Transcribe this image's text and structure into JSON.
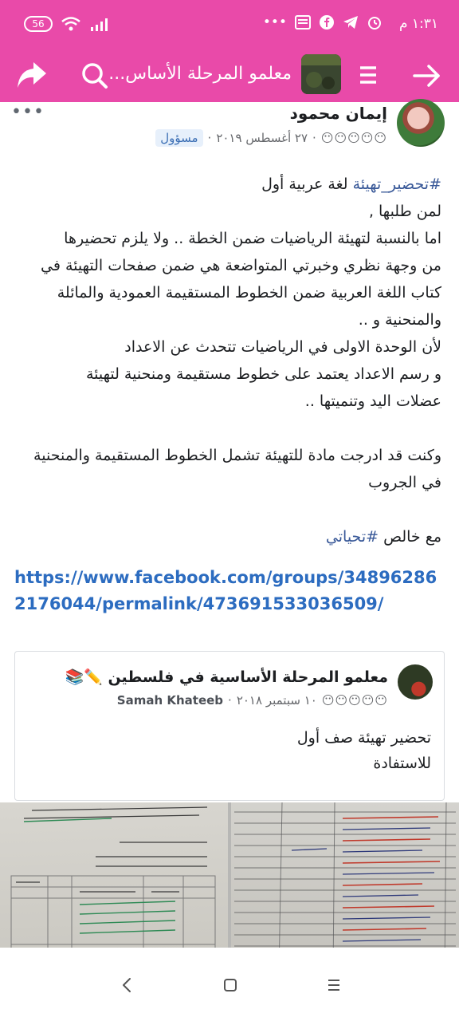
{
  "status_bar": {
    "time": "١:٣١ م",
    "battery": "56",
    "dots": "•••"
  },
  "app_bar": {
    "group_title": "معلمو المرحلة الأساس..."
  },
  "post": {
    "author": "إيمان محمود",
    "role_badge": "مسؤول",
    "date": "٢٧ أغسطس ٢٠١٩",
    "separator": "·",
    "privacy_icons": "😶😶😶😶😶",
    "more": "•••",
    "text": {
      "line1_hashtag": "#تحضير_تهيئة",
      "line1_rest": " لغة عربية أول",
      "line2": "لمن طلبها ,",
      "line3": "اما بالنسبة لتهيئة الرياضيات ضمن الخطة .. ولا يلزم تحضيرها",
      "line4": "من وجهة نظري وخبرتي المتواضعة هي ضمن صفحات التهيئة في",
      "line5": "كتاب اللغة العربية ضمن الخطوط المستقيمة العمودية والمائلة",
      "line6": "والمنحنية و ..",
      "line7": "لأن الوحدة الاولى في الرياضيات تتحدث عن الاعداد",
      "line8": "و رسم الاعداد يعتمد على خطوط مستقيمة ومنحنية لتهيئة",
      "line9": "عضلات اليد وتنميتها ..",
      "line10": "وكنت قد ادرجت مادة للتهيئة تشمل الخطوط المستقيمة والمنحنية",
      "line11": "في الجروب",
      "line12_rest": "مع خالص ",
      "line12_hashtag": "#تحياتي"
    },
    "link": "https://www.facebook.com/groups/348962862176044/permalink/473691533036509/"
  },
  "shared_post": {
    "group_title": "معلمو المرحلة الأساسية في فلسطين ✏️📚",
    "author": "Samah Khateeb",
    "date": "١٠ سبتمبر ٢٠١٨",
    "separator": "·",
    "privacy_icons": "😶😶😶😶😶",
    "text_line1": "تحضير تهيئة صف أول",
    "text_line2": "للاستفادة"
  },
  "colors": {
    "brand_pink": "#e94aa9",
    "link_blue": "#2c6cc0",
    "hashtag_blue": "#385898"
  },
  "icons": {
    "back": "arrow-right-icon",
    "menu": "hamburger-menu-icon",
    "search": "search-icon",
    "share": "share-icon",
    "nav_back": "chevron-left-icon",
    "nav_home": "square-home-icon",
    "nav_recent": "three-lines-icon"
  }
}
